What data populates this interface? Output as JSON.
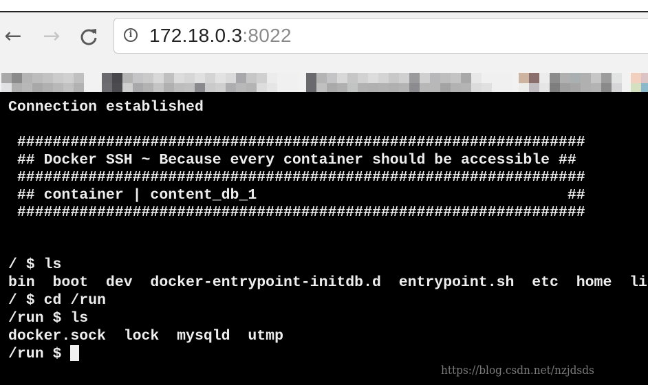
{
  "browser": {
    "nav": {
      "back_icon": "←",
      "forward_icon": "→",
      "reload_icon": "C"
    },
    "address_bar": {
      "info_icon": "i",
      "host": "172.18.0.3",
      "port": ":8022"
    },
    "bookmarks_bar": {
      "note": "blurred"
    }
  },
  "terminal": {
    "lines": [
      "Connection established",
      "",
      " ################################################################",
      " ## Docker SSH ~ Because every container should be accessible ##",
      " ################################################################",
      " ## container | content_db_1                                   ##",
      " ################################################################",
      "",
      "",
      "/ $ ls",
      "bin  boot  dev  docker-entrypoint-initdb.d  entrypoint.sh  etc  home  lib",
      "/ $ cd /run",
      "/run $ ls",
      "docker.sock  lock  mysqld  utmp"
    ],
    "prompt": "/run $ "
  },
  "watermark": "https://blog.csdn.net/nzjdsds"
}
